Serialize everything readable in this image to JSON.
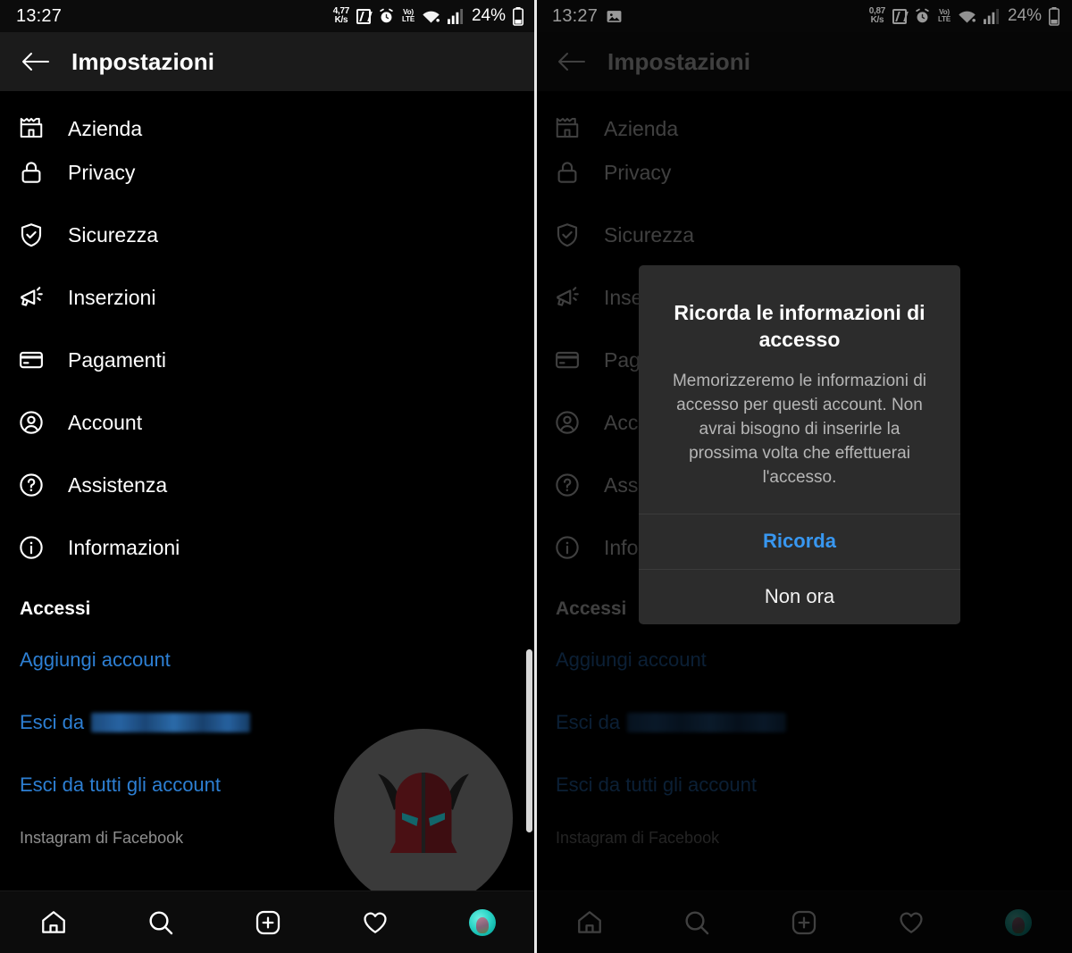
{
  "status_bar": {
    "time": "13:27",
    "left_icon_right_panel": "image-icon",
    "net_speed_left": {
      "value": "4,77",
      "unit": "K/s"
    },
    "net_speed_right": {
      "value": "0,87",
      "unit": "K/s"
    },
    "nfc": "nfc-icon",
    "alarm": "alarm-icon",
    "volte": {
      "top": "Vo)",
      "bottom": "LTE"
    },
    "wifi": "wifi-icon",
    "signal": "cellular-signal-icon",
    "battery_percent": "24%",
    "battery_icon": "battery-icon"
  },
  "header": {
    "back": "back-arrow-icon",
    "title": "Impostazioni"
  },
  "settings": {
    "items": [
      {
        "label": "Azienda",
        "icon": "business-castle-icon"
      },
      {
        "label": "Privacy",
        "icon": "lock-icon"
      },
      {
        "label": "Sicurezza",
        "icon": "shield-check-icon"
      },
      {
        "label": "Inserzioni",
        "icon": "megaphone-icon"
      },
      {
        "label": "Pagamenti",
        "icon": "credit-card-icon"
      },
      {
        "label": "Account",
        "icon": "person-circle-icon"
      },
      {
        "label": "Assistenza",
        "icon": "question-circle-icon"
      },
      {
        "label": "Informazioni",
        "icon": "info-circle-icon"
      }
    ],
    "section_title": "Accessi",
    "links": [
      {
        "label": "Aggiungi account",
        "redacted": false
      },
      {
        "label": "Esci da",
        "redacted": true
      },
      {
        "label": "Esci da tutti gli account",
        "redacted": false
      }
    ],
    "footer": "Instagram di Facebook"
  },
  "dialog": {
    "title": "Ricorda le informazioni di accesso",
    "message": "Memorizzeremo le informazioni di accesso per questi account. Non avrai bisogno di inserirle la prossima volta che effettuerai l'accesso.",
    "primary_button": "Ricorda",
    "secondary_button": "Non ora"
  },
  "bottom_nav": [
    {
      "icon": "home-icon",
      "name": "home"
    },
    {
      "icon": "search-icon",
      "name": "search"
    },
    {
      "icon": "add-post-icon",
      "name": "add"
    },
    {
      "icon": "heart-icon",
      "name": "activity"
    },
    {
      "icon": "avatar-icon",
      "name": "profile"
    }
  ],
  "watermark": {
    "icon": "horned-helmet-logo"
  },
  "colors": {
    "accent_link": "#2d7fd3",
    "dialog_primary": "#3897f0",
    "background": "#000000",
    "appbar": "#1b1b1b",
    "dialog_bg": "#2c2c2c"
  }
}
